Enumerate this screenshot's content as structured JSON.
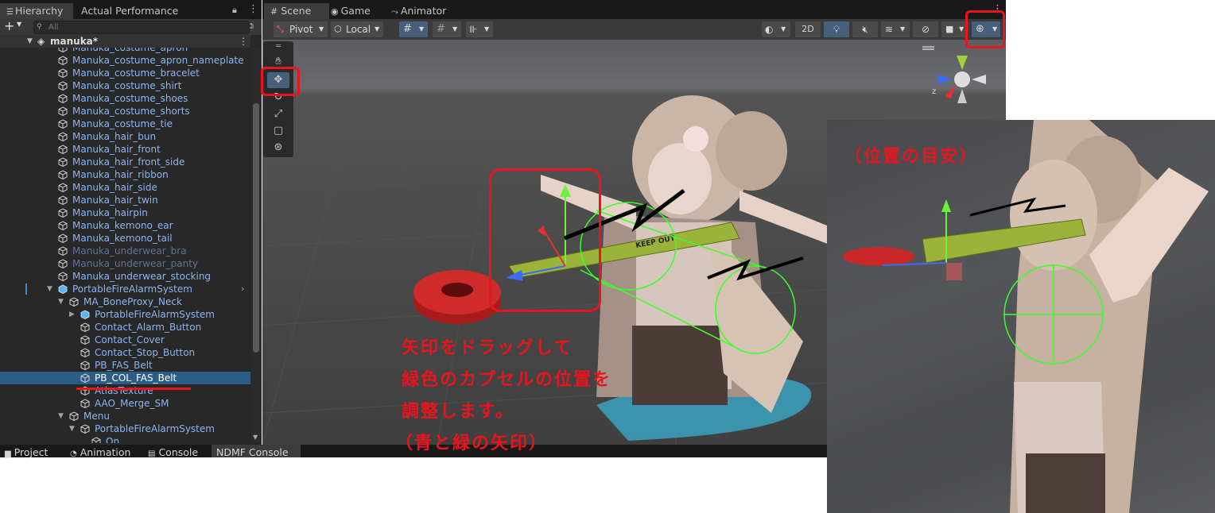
{
  "hierarchy": {
    "tabs": [
      "Hierarchy",
      "Actual Performance"
    ],
    "search_placeholder": "All",
    "scene_name": "manuka*",
    "items": [
      {
        "label": "Manuka_costume_apron",
        "indent": 1,
        "state": "normal"
      },
      {
        "label": "Manuka_costume_apron_nameplate",
        "indent": 1,
        "state": "normal"
      },
      {
        "label": "Manuka_costume_bracelet",
        "indent": 1,
        "state": "normal"
      },
      {
        "label": "Manuka_costume_shirt",
        "indent": 1,
        "state": "normal"
      },
      {
        "label": "Manuka_costume_shoes",
        "indent": 1,
        "state": "normal"
      },
      {
        "label": "Manuka_costume_shorts",
        "indent": 1,
        "state": "normal"
      },
      {
        "label": "Manuka_costume_tie",
        "indent": 1,
        "state": "normal"
      },
      {
        "label": "Manuka_hair_bun",
        "indent": 1,
        "state": "normal"
      },
      {
        "label": "Manuka_hair_front",
        "indent": 1,
        "state": "normal"
      },
      {
        "label": "Manuka_hair_front_side",
        "indent": 1,
        "state": "normal"
      },
      {
        "label": "Manuka_hair_ribbon",
        "indent": 1,
        "state": "normal"
      },
      {
        "label": "Manuka_hair_side",
        "indent": 1,
        "state": "normal"
      },
      {
        "label": "Manuka_hair_twin",
        "indent": 1,
        "state": "normal"
      },
      {
        "label": "Manuka_hairpin",
        "indent": 1,
        "state": "normal"
      },
      {
        "label": "Manuka_kemono_ear",
        "indent": 1,
        "state": "normal"
      },
      {
        "label": "Manuka_kemono_tail",
        "indent": 1,
        "state": "normal"
      },
      {
        "label": "Manuka_underwear_bra",
        "indent": 1,
        "state": "dim"
      },
      {
        "label": "Manuka_underwear_panty",
        "indent": 1,
        "state": "dim"
      },
      {
        "label": "Manuka_underwear_stocking",
        "indent": 1,
        "state": "normal"
      },
      {
        "label": "PortableFireAlarmSystem",
        "indent": 1,
        "state": "prefab-open"
      },
      {
        "label": "MA_BoneProxy_Neck",
        "indent": 2,
        "state": "open"
      },
      {
        "label": "PortableFireAlarmSystem",
        "indent": 3,
        "state": "prefab-closed"
      },
      {
        "label": "Contact_Alarm_Button",
        "indent": 3,
        "state": "normal"
      },
      {
        "label": "Contact_Cover",
        "indent": 3,
        "state": "normal"
      },
      {
        "label": "Contact_Stop_Button",
        "indent": 3,
        "state": "normal"
      },
      {
        "label": "PB_FAS_Belt",
        "indent": 3,
        "state": "normal"
      },
      {
        "label": "PB_COL_FAS_Belt",
        "indent": 3,
        "state": "selected"
      },
      {
        "label": "AtlasTexture",
        "indent": 3,
        "state": "normal"
      },
      {
        "label": "AAO_Merge_SM",
        "indent": 3,
        "state": "normal"
      },
      {
        "label": "Menu",
        "indent": 2,
        "state": "open"
      },
      {
        "label": "PortableFireAlarmSystem",
        "indent": 3,
        "state": "open"
      },
      {
        "label": "On",
        "indent": 4,
        "state": "normal"
      }
    ]
  },
  "scene_tabs": [
    "Scene",
    "Game",
    "Animator"
  ],
  "toolbar": {
    "pivot": "Pivot",
    "local": "Local",
    "mode_2d": "2D"
  },
  "bottom_tabs": [
    "Project",
    "Animation",
    "Console",
    "NDMF Console"
  ],
  "annotation": {
    "instruction_lines": [
      "矢印をドラッグして",
      "緑色のカプセルの位置を",
      "調整します。",
      "（青と緑の矢印）"
    ],
    "inset_caption": "（位置の目安）"
  },
  "scene_labels": {
    "tape_text": "KEEP OUT",
    "gizmo_axis_z": "z"
  },
  "colors": {
    "annotation_red": "#e8141e",
    "selection_blue": "#2c5d87",
    "link_blue": "#8cb4f0"
  }
}
